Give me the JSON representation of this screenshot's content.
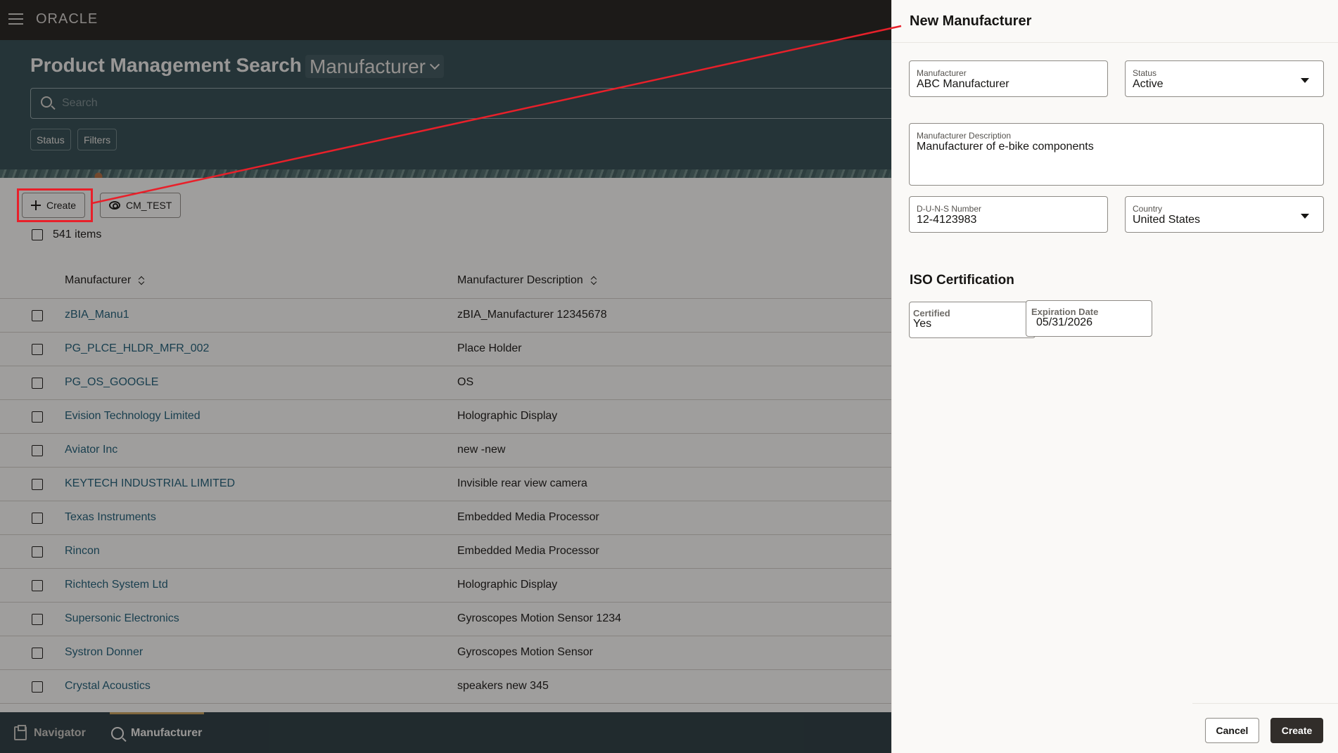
{
  "header": {
    "menu_icon": "hamburger-icon",
    "logo": "ORACLE"
  },
  "page": {
    "title": "Product Management Search",
    "object_picker": "Manufacturer",
    "search_placeholder": "Search",
    "search_value": "",
    "chips": [
      "Status",
      "Filters"
    ]
  },
  "toolbar": {
    "create_label": "Create",
    "saved_search_label": "CM_TEST"
  },
  "results": {
    "count_label": "541 items",
    "columns": [
      "Manufacturer",
      "Manufacturer Description"
    ],
    "rows": [
      {
        "manufacturer": "zBIA_Manu1",
        "description": "zBIA_Manufacturer 12345678"
      },
      {
        "manufacturer": "PG_PLCE_HLDR_MFR_002",
        "description": "Place Holder"
      },
      {
        "manufacturer": "PG_OS_GOOGLE",
        "description": "OS"
      },
      {
        "manufacturer": "Evision Technology Limited",
        "description": "Holographic Display"
      },
      {
        "manufacturer": "Aviator Inc",
        "description": "new -new"
      },
      {
        "manufacturer": "KEYTECH INDUSTRIAL LIMITED",
        "description": "Invisible rear view camera"
      },
      {
        "manufacturer": "Texas Instruments",
        "description": "Embedded Media Processor"
      },
      {
        "manufacturer": "Rincon",
        "description": "Embedded Media Processor"
      },
      {
        "manufacturer": "Richtech System Ltd",
        "description": "Holographic Display"
      },
      {
        "manufacturer": "Supersonic Electronics",
        "description": "Gyroscopes Motion Sensor 1234"
      },
      {
        "manufacturer": "Systron Donner",
        "description": "Gyroscopes Motion Sensor"
      },
      {
        "manufacturer": "Crystal Acoustics",
        "description": "speakers new 345"
      }
    ]
  },
  "bottom_nav": {
    "items": [
      {
        "label": "Navigator",
        "icon": "navigator-icon",
        "active": false
      },
      {
        "label": "Manufacturer",
        "icon": "search-icon",
        "active": true
      }
    ]
  },
  "drawer": {
    "title": "New Manufacturer",
    "fields": {
      "manufacturer": {
        "label": "Manufacturer",
        "value": "ABC Manufacturer"
      },
      "status": {
        "label": "Status",
        "value": "Active"
      },
      "description": {
        "label": "Manufacturer Description",
        "value": "Manufacturer of e-bike components"
      },
      "duns": {
        "label": "D-U-N-S Number",
        "value": "12-4123983"
      },
      "country": {
        "label": "Country",
        "value": "United States"
      }
    },
    "iso_section": {
      "title": "ISO Certification",
      "certified": {
        "label": "Certified",
        "value": "Yes"
      },
      "expiration": {
        "label": "Expiration Date",
        "value": "05/31/2026"
      }
    },
    "cancel_label": "Cancel",
    "create_label": "Create"
  },
  "colors": {
    "accent_dark": "#312d2a",
    "link": "#1c5d77",
    "banner": "#2f4a50",
    "annotation": "#e8202a",
    "nav_active": "#c9a05a"
  }
}
